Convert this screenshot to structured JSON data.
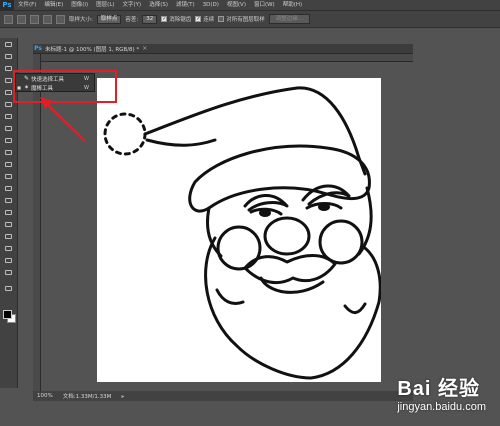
{
  "app": {
    "logo": "Ps"
  },
  "menu": [
    "文件(F)",
    "编辑(E)",
    "图像(I)",
    "图层(L)",
    "文字(Y)",
    "选择(S)",
    "滤镜(T)",
    "3D(D)",
    "视图(V)",
    "窗口(W)",
    "帮助(H)"
  ],
  "options": {
    "sample_size_label": "取样大小:",
    "sample_size_value": "取样点",
    "tolerance_label": "容差:",
    "tolerance_value": "32",
    "antialias_label": "消除锯齿",
    "contiguous_label": "连续",
    "sample_all_layers_label": "对所有图层取样",
    "refine_edge_label": "调整边缘..."
  },
  "document": {
    "title": "未标题-1 @ 100% (图层 1, RGB/8) *",
    "zoom": "100%",
    "info": "文档:1.33M/1.33M"
  },
  "flyout": {
    "items": [
      {
        "label": "快速选择工具",
        "key": "W",
        "icon": "quick-select-icon"
      },
      {
        "label": "魔棒工具",
        "key": "W",
        "icon": "magic-wand-icon",
        "active": true
      }
    ]
  },
  "colors": {
    "highlight": "#e01f26",
    "ps_blue": "#31a8ff"
  },
  "watermark": {
    "logo": "Bai  经验",
    "sub": "jingyan.baidu.com"
  }
}
